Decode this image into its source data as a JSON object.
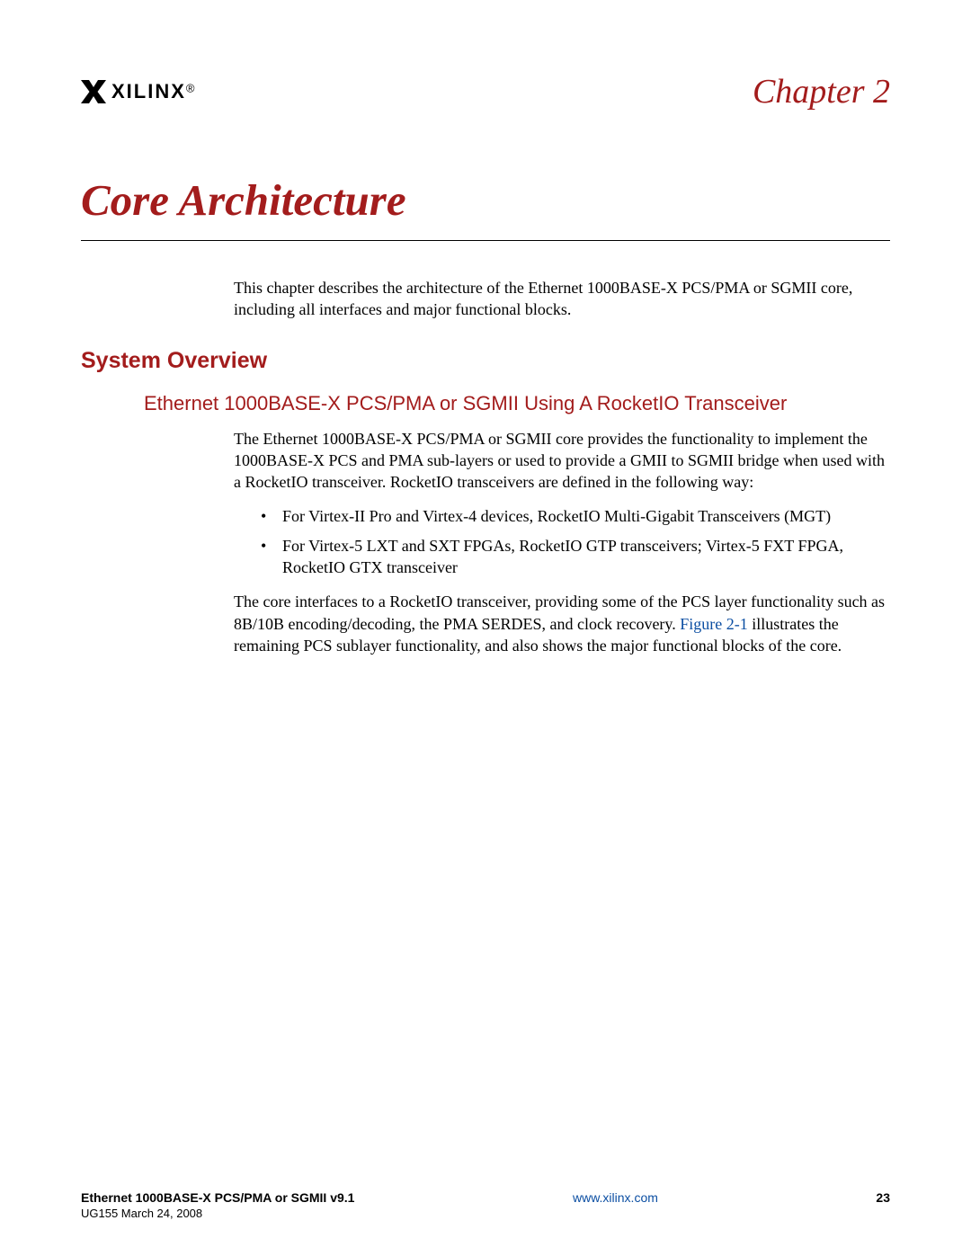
{
  "header": {
    "logo_text": "XILINX",
    "chapter_label": "Chapter 2"
  },
  "title": "Core Architecture",
  "intro": "This chapter describes the architecture of the Ethernet 1000BASE-X PCS/PMA or SGMII core, including all interfaces and major functional blocks.",
  "section": {
    "h2": "System Overview",
    "h3": "Ethernet 1000BASE-X PCS/PMA or SGMII Using A RocketIO Transceiver",
    "p1": "The Ethernet 1000BASE-X PCS/PMA or SGMII core provides the functionality to implement the 1000BASE-X PCS and PMA sub-layers or used to provide a GMII to SGMII bridge when used with a RocketIO transceiver. RocketIO transceivers are defined in the following way:",
    "bullets": [
      "For Virtex-II Pro and Virtex-4 devices, RocketIO Multi-Gigabit Transceivers (MGT)",
      "For Virtex-5 LXT and SXT FPGAs, RocketIO GTP transceivers; Virtex-5 FXT FPGA, RocketIO GTX transceiver"
    ],
    "p2_a": "The core interfaces to a RocketIO transceiver, providing some of the PCS layer functionality such as 8B/10B encoding/decoding, the PMA SERDES, and clock recovery. ",
    "figref": "Figure 2-1",
    "p2_b": " illustrates the remaining PCS sublayer functionality, and also shows the major functional blocks of the core."
  },
  "footer": {
    "doc_title": "Ethernet 1000BASE-X PCS/PMA or SGMII v9.1",
    "link": "www.xilinx.com",
    "page_num": "23",
    "doc_id": "UG155 March 24, 2008"
  }
}
